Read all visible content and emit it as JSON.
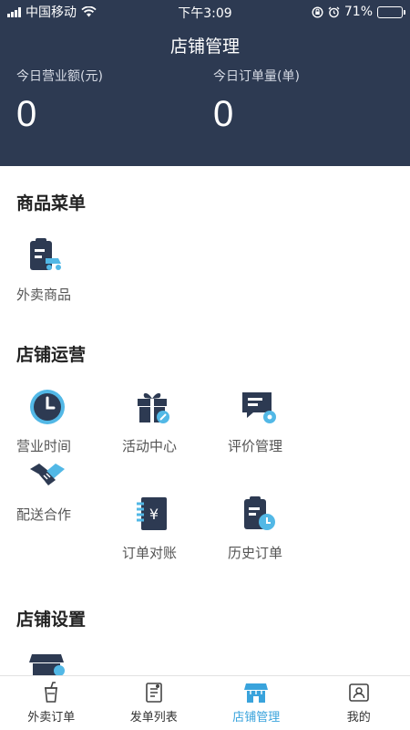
{
  "status_bar": {
    "carrier": "中国移动",
    "time": "下午3:09",
    "battery": "71%",
    "battery_level": 0.71
  },
  "header": {
    "title": "店铺管理",
    "stats": [
      {
        "label": "今日营业额(元)",
        "value": "0"
      },
      {
        "label": "今日订单量(单)",
        "value": "0"
      }
    ]
  },
  "sections": {
    "menu": {
      "title": "商品菜单",
      "items": [
        {
          "label": "外卖商品",
          "icon": "takeout-goods-icon"
        }
      ]
    },
    "operations": {
      "title": "店铺运营",
      "items": [
        {
          "label": "营业时间",
          "icon": "clock-icon"
        },
        {
          "label": "活动中心",
          "icon": "gift-icon"
        },
        {
          "label": "评价管理",
          "icon": "comment-settings-icon"
        },
        {
          "label": "配送合作",
          "icon": "handshake-icon"
        },
        {
          "label": "订单对账",
          "icon": "yen-ledger-icon"
        },
        {
          "label": "历史订单",
          "icon": "clipboard-clock-icon"
        }
      ]
    },
    "settings": {
      "title": "店铺设置",
      "items": [
        {
          "label": "",
          "icon": "storefront-settings-icon"
        }
      ]
    }
  },
  "tabbar": {
    "items": [
      {
        "label": "外卖订单",
        "icon": "takeout-cup-icon"
      },
      {
        "label": "发单列表",
        "icon": "document-list-icon"
      },
      {
        "label": "店铺管理",
        "icon": "store-icon"
      },
      {
        "label": "我的",
        "icon": "profile-icon"
      }
    ],
    "active_index": 2
  },
  "colors": {
    "header_bg": "#2d3a52",
    "icon_dark": "#2d3a52",
    "icon_accent": "#52b8e6",
    "tab_active": "#39a3dc"
  }
}
